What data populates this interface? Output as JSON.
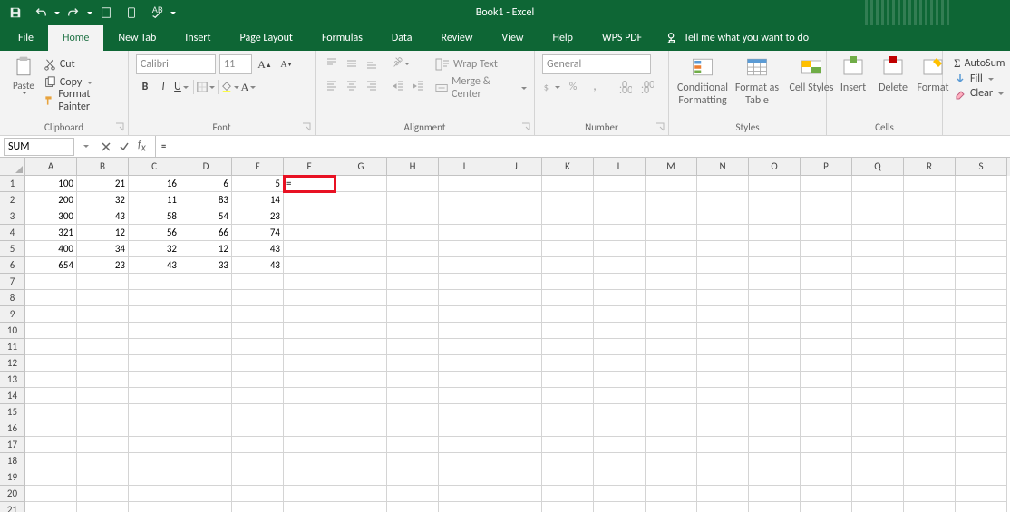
{
  "title": "Book1 - Excel",
  "tabs": [
    "File",
    "Home",
    "New Tab",
    "Insert",
    "Page Layout",
    "Formulas",
    "Data",
    "Review",
    "View",
    "Help",
    "WPS PDF"
  ],
  "active_tab": 1,
  "tell_me": "Tell me what you want to do",
  "clipboard": {
    "paste": "Paste",
    "cut": "Cut",
    "copy": "Copy",
    "fp": "Format Painter",
    "label": "Clipboard"
  },
  "font": {
    "name": "Calibri",
    "size": "11",
    "label": "Font"
  },
  "alignment": {
    "wrap": "Wrap Text",
    "merge": "Merge & Center",
    "label": "Alignment"
  },
  "number": {
    "format": "General",
    "label": "Number"
  },
  "styles": {
    "cf": "Conditional Formatting",
    "ft": "Format as Table",
    "cs": "Cell Styles",
    "label": "Styles"
  },
  "cells": {
    "insert": "Insert",
    "delete": "Delete",
    "format": "Format",
    "label": "Cells"
  },
  "editing": {
    "autosum": "AutoSum",
    "fill": "Fill",
    "clear": "Clear"
  },
  "name_box": "SUM",
  "formula": "=",
  "columns": [
    "A",
    "B",
    "C",
    "D",
    "E",
    "F",
    "G",
    "H",
    "I",
    "J",
    "K",
    "L",
    "M",
    "N",
    "O",
    "P",
    "Q",
    "R",
    "S"
  ],
  "sheet": [
    [
      "100",
      "21",
      "16",
      "6",
      "5",
      "="
    ],
    [
      "200",
      "32",
      "11",
      "83",
      "14",
      ""
    ],
    [
      "300",
      "43",
      "58",
      "54",
      "23",
      ""
    ],
    [
      "321",
      "12",
      "56",
      "66",
      "74",
      ""
    ],
    [
      "400",
      "34",
      "32",
      "12",
      "43",
      ""
    ],
    [
      "654",
      "23",
      "43",
      "33",
      "43",
      ""
    ]
  ],
  "row_count": 21,
  "active_cell": {
    "r": 0,
    "c": 5
  }
}
